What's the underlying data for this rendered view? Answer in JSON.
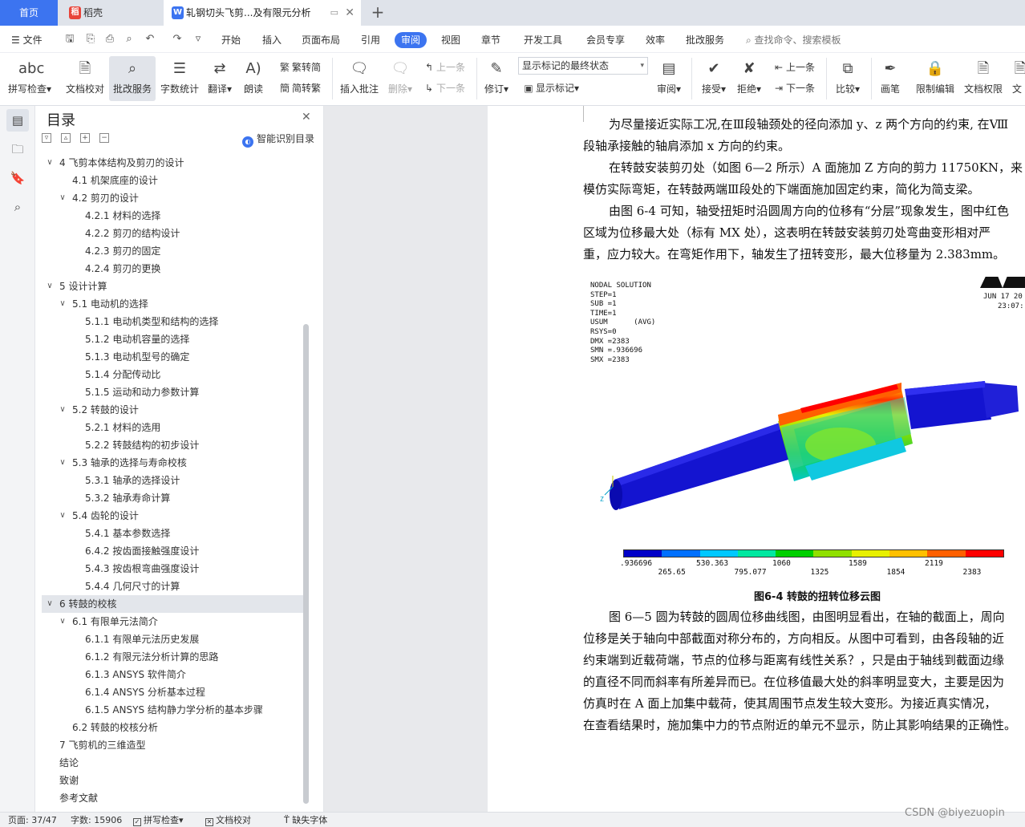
{
  "tabs": {
    "home": "首页",
    "daoke": "稻壳",
    "document": "轧钢切头飞剪...及有限元分析"
  },
  "menu": {
    "file": "文件",
    "items": [
      "开始",
      "插入",
      "页面布局",
      "引用",
      "审阅",
      "视图",
      "章节",
      "开发工具",
      "会员专享",
      "效率",
      "批改服务"
    ],
    "active": "审阅",
    "search": "查找命令、搜索模板"
  },
  "ribbon": {
    "spell_check": "拼写检查",
    "doc_proof": "文档校对",
    "review_service": "批改服务",
    "word_count": "字数统计",
    "translate": "翻译",
    "read_aloud": "朗读",
    "trad_to_simp": "繁转简",
    "simp_to_trad": "简转繁",
    "insert_comment": "插入批注",
    "delete": "删除",
    "prev_comment": "上一条",
    "next_comment": "下一条",
    "revise": "修订",
    "markup_state": "显示标记的最终状态",
    "show_markup": "显示标记",
    "review": "审阅",
    "accept": "接受",
    "reject": "拒绝",
    "prev_change": "上一条",
    "next_change": "下一条",
    "compare": "比较",
    "pen": "画笔",
    "restrict_edit": "限制编辑",
    "doc_rights": "文档权限",
    "doc_more": "文"
  },
  "nav": {
    "title": "目录",
    "smart_toc": "智能识别目录",
    "items": [
      {
        "text": "4 飞剪本体结构及剪刃的设计",
        "level": 1,
        "exp": "open"
      },
      {
        "text": "4.1 机架底座的设计",
        "level": 2,
        "exp": "none"
      },
      {
        "text": "4.2 剪刃的设计",
        "level": 2,
        "exp": "open"
      },
      {
        "text": "4.2.1 材料的选择",
        "level": 3,
        "exp": "none"
      },
      {
        "text": "4.2.2 剪刃的结构设计",
        "level": 3,
        "exp": "none"
      },
      {
        "text": "4.2.3 剪刃的固定",
        "level": 3,
        "exp": "none"
      },
      {
        "text": "4.2.4 剪刃的更换",
        "level": 3,
        "exp": "none"
      },
      {
        "text": "5 设计计算",
        "level": 1,
        "exp": "open"
      },
      {
        "text": "5.1 电动机的选择",
        "level": 2,
        "exp": "open"
      },
      {
        "text": "5.1.1 电动机类型和结构的选择",
        "level": 3,
        "exp": "none"
      },
      {
        "text": "5.1.2 电动机容量的选择",
        "level": 3,
        "exp": "none"
      },
      {
        "text": "5.1.3 电动机型号的确定",
        "level": 3,
        "exp": "none"
      },
      {
        "text": "5.1.4 分配传动比",
        "level": 3,
        "exp": "none"
      },
      {
        "text": "5.1.5 运动和动力参数计算",
        "level": 3,
        "exp": "none"
      },
      {
        "text": "5.2 转鼓的设计",
        "level": 2,
        "exp": "open"
      },
      {
        "text": "5.2.1 材料的选用",
        "level": 3,
        "exp": "none"
      },
      {
        "text": "5.2.2 转鼓结构的初步设计",
        "level": 3,
        "exp": "none"
      },
      {
        "text": "5.3 轴承的选择与寿命校核",
        "level": 2,
        "exp": "open"
      },
      {
        "text": "5.3.1 轴承的选择设计",
        "level": 3,
        "exp": "none"
      },
      {
        "text": "5.3.2 轴承寿命计算",
        "level": 3,
        "exp": "none"
      },
      {
        "text": "5.4 齿轮的设计",
        "level": 2,
        "exp": "open"
      },
      {
        "text": "5.4.1 基本参数选择",
        "level": 3,
        "exp": "none"
      },
      {
        "text": "6.4.2 按齿面接触强度设计",
        "level": 3,
        "exp": "none"
      },
      {
        "text": "5.4.3 按齿根弯曲强度设计",
        "level": 3,
        "exp": "none"
      },
      {
        "text": "5.4.4 几何尺寸的计算",
        "level": 3,
        "exp": "none"
      },
      {
        "text": "6 转鼓的校核",
        "level": 1,
        "exp": "open",
        "selected": true
      },
      {
        "text": "6.1 有限单元法简介",
        "level": 2,
        "exp": "open"
      },
      {
        "text": "6.1.1 有限单元法历史发展",
        "level": 3,
        "exp": "none"
      },
      {
        "text": "6.1.2 有限元法分析计算的思路",
        "level": 3,
        "exp": "none"
      },
      {
        "text": "6.1.3 ANSYS 软件简介",
        "level": 3,
        "exp": "none"
      },
      {
        "text": "6.1.4 ANSYS 分析基本过程",
        "level": 3,
        "exp": "none"
      },
      {
        "text": "6.1.5 ANSYS 结构静力学分析的基本步骤",
        "level": 3,
        "exp": "none"
      },
      {
        "text": "6.2 转鼓的校核分析",
        "level": 2,
        "exp": "none"
      },
      {
        "text": "7 飞剪机的三维造型",
        "level": 1,
        "exp": "none"
      },
      {
        "text": "结论",
        "level": 1,
        "exp": "none"
      },
      {
        "text": "致谢",
        "level": 1,
        "exp": "none"
      },
      {
        "text": "参考文献",
        "level": 1,
        "exp": "none"
      }
    ]
  },
  "document": {
    "para1": [
      "为尽量接近实际工况,在Ⅲ段轴颈处的径向添加 y、z 两个方向的约束, 在Ⅷ",
      "段轴承接触的轴肩添加 x 方向的约束。"
    ],
    "para2": [
      "在转鼓安装剪刃处（如图 6—2 所示）A 面施加 Z 方向的剪力 11750KN，来",
      "模仿实际弯矩，在转鼓两端Ⅲ段处的下端面施加固定约束，简化为简支梁。"
    ],
    "para3": [
      "由图 6-4 可知，轴受扭矩时沿圆周方向的位移有“分层”现象发生，图中红色",
      "区域为位移最大处（标有 MX 处），这表明在转鼓安装剪刃处弯曲变形相对严",
      "重，应力较大。在弯矩作用下，轴发生了扭转变形，最大位移量为 2.383mm。"
    ],
    "caption": "图6-4 转鼓的扭转位移云图",
    "para4": [
      "图 6—5 圆为转鼓的圆周位移曲线图，由图明显看出，在轴的截面上，周向",
      "位移是关于轴向中部截面对称分布的，方向相反。从图中可看到，由各段轴的近",
      "约束端到近载荷端，节点的位移与距离有线性关系？，只是由于轴线到截面边缘",
      "的直径不同而斜率有所差异而已。在位移值最大处的斜率明显变大，主要是因为",
      "仿真时在 A 面上加集中载荷，使其周围节点发生较大变形。为接近真实情况，",
      "在查看结果时，施加集中力的节点附近的单元不显示，防止其影响结果的正确性。"
    ]
  },
  "figure": {
    "info_lines": [
      "NODAL SOLUTION",
      "",
      "STEP=1",
      "SUB =1",
      "TIME=1",
      "USUM      (AVG)",
      "RSYS=0",
      "DMX =2383",
      "SMN =.936696",
      "SMX =2383"
    ],
    "date": "JUN 17 20",
    "time": "23:07:",
    "legend_top": [
      ".936696",
      "530.363",
      "1060",
      "1589",
      "2119"
    ],
    "legend_bottom": [
      "265.65",
      "795.077",
      "1325",
      "1854",
      "2383"
    ],
    "legend_colors": [
      "#0000c8",
      "#0070ff",
      "#00c8ff",
      "#00e8a0",
      "#00d000",
      "#90e000",
      "#e8f000",
      "#ffc000",
      "#ff6000",
      "#ff0000"
    ],
    "axis_label": "Z"
  },
  "status": {
    "page": "页面: 37/47",
    "words": "字数: 15906",
    "spell": "拼写检查",
    "proof": "文档校对",
    "missing_font": "缺失字体"
  },
  "watermark": "CSDN @biyezuopin"
}
